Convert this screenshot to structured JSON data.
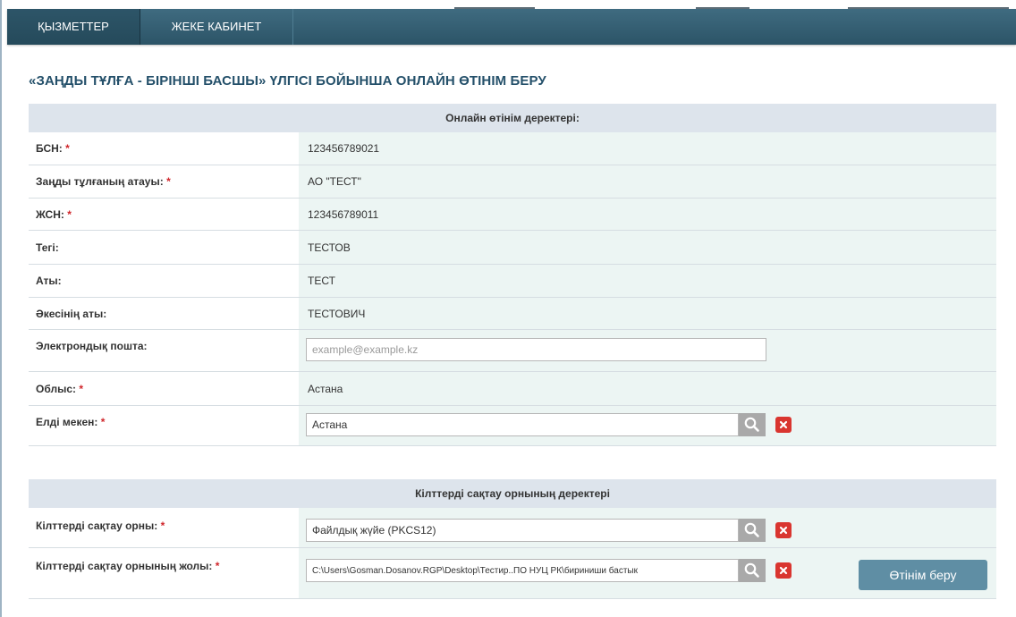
{
  "nav": {
    "tabs": [
      {
        "label": "ҚЫЗМЕТТЕР"
      },
      {
        "label": "ЖЕКЕ КАБИНЕТ"
      }
    ]
  },
  "page": {
    "title": "«ЗАҢДЫ ТҰЛҒА - БІРІНШІ БАСШЫ» ҮЛГІСІ БОЙЫНША ОНЛАЙН ӨТІНІМ БЕРУ"
  },
  "application": {
    "header": "Онлайн өтінім деректері:",
    "required_mark": "*",
    "bin": {
      "label": "БСН:",
      "value": "123456789021"
    },
    "company_name": {
      "label": "Заңды тұлғаның атауы:",
      "value": "АО \"ТЕСТ\""
    },
    "iin": {
      "label": "ЖСН:",
      "value": "123456789011"
    },
    "surname": {
      "label": "Тегі:",
      "value": "ТЕСТОВ"
    },
    "name": {
      "label": "Аты:",
      "value": "ТЕСТ"
    },
    "patronymic": {
      "label": "Әкесінің аты:",
      "value": "ТЕСТОВИЧ"
    },
    "email": {
      "label": "Электрондық пошта:",
      "value": "",
      "placeholder": "example@example.kz"
    },
    "region": {
      "label": "Облыс:",
      "value": "Астана"
    },
    "locality": {
      "label": "Елді мекен:",
      "value": "Астана"
    }
  },
  "keystore": {
    "header": "Кілттерді сақтау орнының деректері",
    "type": {
      "label": "Кілттерді сақтау орны:",
      "value": "Файлдық жүйе (PKCS12)"
    },
    "path": {
      "label": "Кілттерді сақтау орнының жолы:",
      "value": "C:\\Users\\Gosman.Dosanov.RGP\\Desktop\\Тестир..ПО НУЦ РК\\бириниши бастык"
    }
  },
  "actions": {
    "submit_label": "Өтінім беру"
  },
  "colors": {
    "nav_background": "#2c5467",
    "title": "#24506a",
    "section_header": "#dde4ec",
    "value_cell": "#ecf5f3",
    "required": "#d0262b",
    "delete_button": "#d9352f",
    "search_button": "#a9a9a9",
    "submit_button": "#5f8ea4"
  },
  "icons": {
    "search_button": "search-icon",
    "delete_button": "close-icon"
  }
}
